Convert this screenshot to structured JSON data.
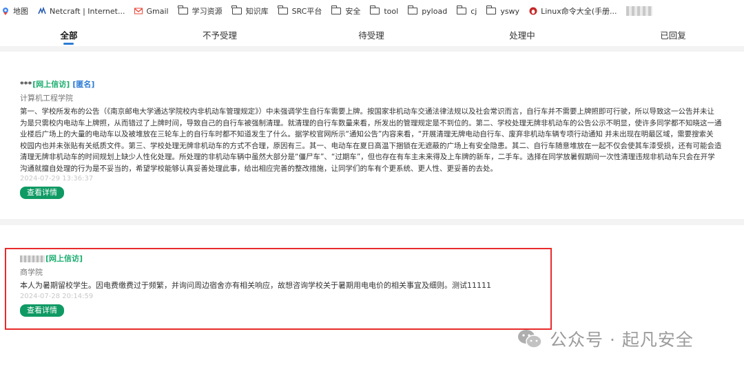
{
  "bookmarks": [
    {
      "label": "地图",
      "icon": "map-icon"
    },
    {
      "label": "Netcraft | Internet...",
      "icon": "netcraft-icon"
    },
    {
      "label": "Gmail",
      "icon": "gmail-icon"
    },
    {
      "label": "学习资源",
      "icon": "folder-icon"
    },
    {
      "label": "知识库",
      "icon": "folder-icon"
    },
    {
      "label": "SRC平台",
      "icon": "folder-icon"
    },
    {
      "label": "安全",
      "icon": "folder-icon"
    },
    {
      "label": "tool",
      "icon": "folder-icon"
    },
    {
      "label": "pyload",
      "icon": "folder-icon"
    },
    {
      "label": "cj",
      "icon": "folder-icon"
    },
    {
      "label": "yswy",
      "icon": "folder-icon"
    },
    {
      "label": "Linux命令大全(手册...",
      "icon": "linux-icon"
    }
  ],
  "tabs": [
    "全部",
    "不予受理",
    "待受理",
    "处理中",
    "已回复"
  ],
  "active_tab": "全部",
  "posts": [
    {
      "poster": "***",
      "tag": "[网上信访]",
      "tag2": "[匿名]",
      "dept": "计算机工程学院",
      "lines": [
        "第一、学校所发布的公告（《南京邮电大学通达学院校内非机动车管理规定》）中未强调学生自行车需要上牌。按国家非机动车交通法律法规以及社会常识而言，自行车并不需要上牌照即可行驶，所以导致这一公告并未让",
        "为是只需校内电动车上牌照，从而错过了上牌时间，导致自己的自行车被强制清理。就清理的自行车数量来看，所发出的管理规定是不到位的。第二、学校处理无牌非机动车的公告公示不明显，使许多同学都不知晓这一通",
        "业楼后广场上的大量的电动车以及被堆放在三轮车上的自行车时都不知道发生了什么。据学校官网所示“通知公告”内容来看，“开展清理无牌电动自行车、废弃非机动车辆专项行动通知 并未出现在明最区域，需要搜索关",
        "校园内也并未张贴有关纸质文件。第三、学校处理无牌非机动车的方式不合理，原因有三。其一、电动车在夏日高温下捆锁在无遮蔽的广场上有安全隐患。其二、自行车随意堆放在一起不仅会使其车漆受损，还有可能会造",
        "清理无牌非机动车的时间规划上缺少人性化处理。所处理的非机动车辆中虽然大部分是“僵尸车”、“过期车”，但也存在有车主未来得及上车牌的新车，二手车。选择在同学放暑假期间一次性清理违规非机动车只会在开学",
        "沟通就擅自处理的行为是不妥当的，希望学校能够认真妥善处理此事，给出相应完善的整改措施，让同学们的车有个更系统、更人性、更妥善的去处。"
      ],
      "date": "2024-07-29 13:36:37",
      "button": "查看详情"
    },
    {
      "poster": "",
      "tag": "[网上信访]",
      "dept": "商学院",
      "lines": [
        "本人为暑期留校学生。因电费缴费过于频繁，并询问周边宿舍亦有相关响应，故想咨询学校关于暑期用电电价的相关事宜及细则。测试11111"
      ],
      "date": "2024-07-28 20:14:59",
      "button": "查看详情"
    }
  ],
  "watermark": "公众号 · 起凡安全",
  "colors": {
    "accent": "#2b7bd4",
    "button": "#0f9a64",
    "tag": "#1aad6e",
    "highlight_box": "#e82a2a"
  }
}
